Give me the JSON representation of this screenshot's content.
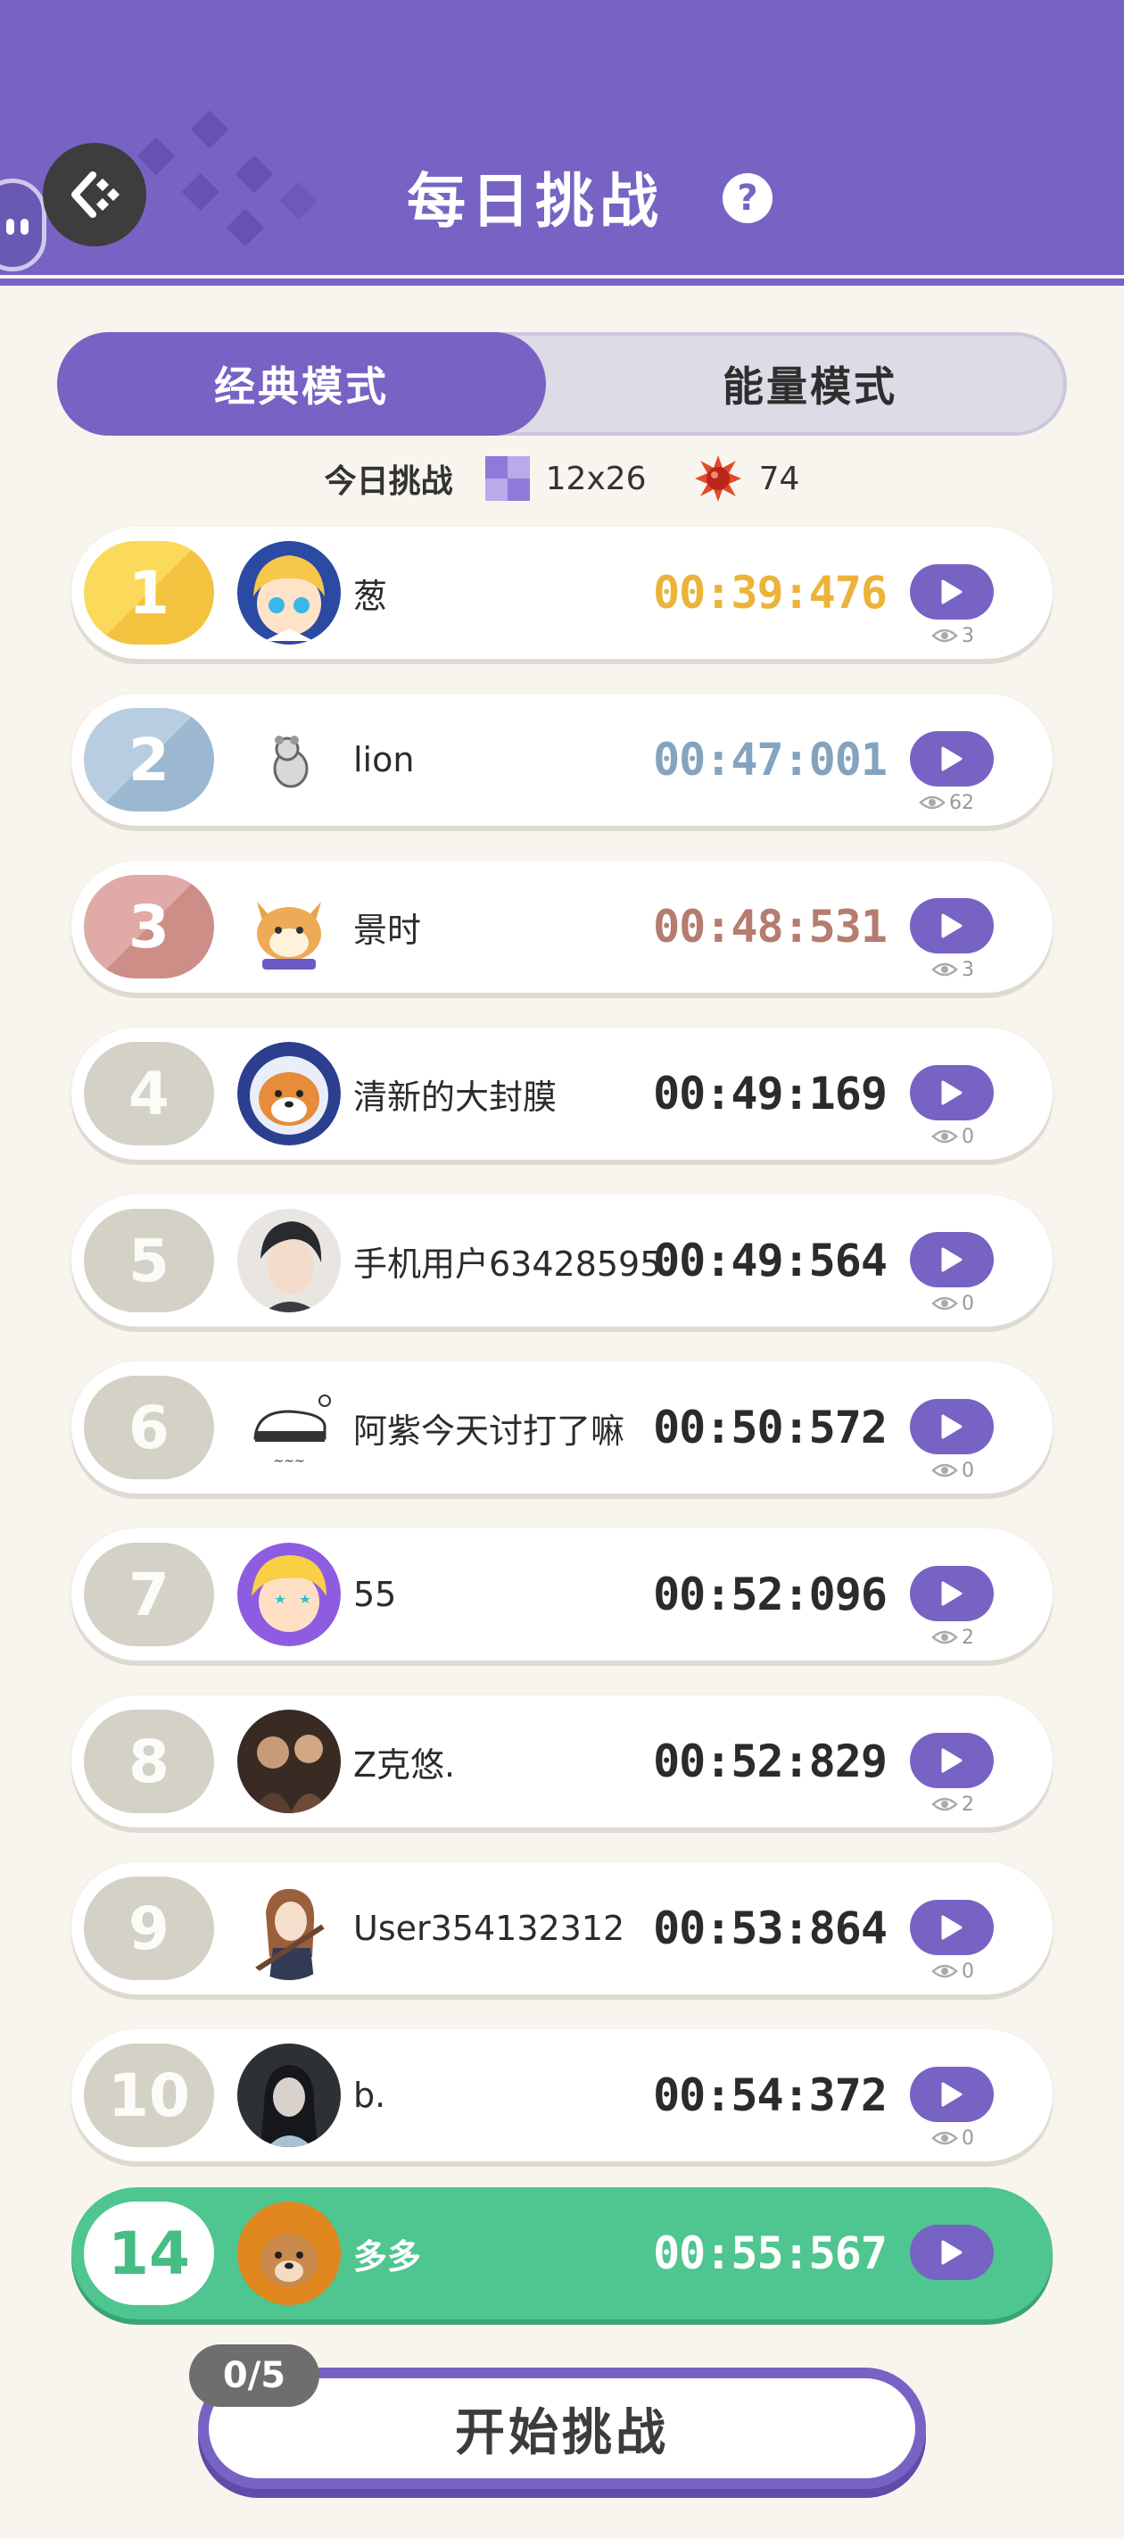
{
  "header": {
    "title": "每日挑战",
    "help": "?"
  },
  "tabs": [
    {
      "label": "经典模式",
      "active": true
    },
    {
      "label": "能量模式",
      "active": false
    }
  ],
  "today": {
    "label": "今日挑战",
    "board_size": "12x26",
    "mine_count": "74"
  },
  "leaderboard": [
    {
      "rank": "1",
      "name": "葱",
      "time": "00:39:476",
      "views": "3",
      "avatar": "anime-girl-blonde"
    },
    {
      "rank": "2",
      "name": "lion",
      "time": "00:47:001",
      "views": "62",
      "avatar": "cartoon-animal-sketch"
    },
    {
      "rank": "3",
      "name": "景时",
      "time": "00:48:531",
      "views": "3",
      "avatar": "shiba-dog-cartoon"
    },
    {
      "rank": "4",
      "name": "清新的大封膜",
      "time": "00:49:169",
      "views": "0",
      "avatar": "shiba-astronaut"
    },
    {
      "rank": "5",
      "name": "手机用户63428595",
      "time": "00:49:564",
      "views": "0",
      "avatar": "anime-boy"
    },
    {
      "rank": "6",
      "name": "阿紫今天讨打了嘛",
      "time": "00:50:572",
      "views": "0",
      "avatar": "doodle-cat"
    },
    {
      "rank": "7",
      "name": "55",
      "time": "00:52:096",
      "views": "2",
      "avatar": "anime-girl-star-eyes"
    },
    {
      "rank": "8",
      "name": "Z克悠.",
      "time": "00:52:829",
      "views": "2",
      "avatar": "photo-people"
    },
    {
      "rank": "9",
      "name": "User354132312",
      "time": "00:53:864",
      "views": "0",
      "avatar": "anime-guitar-girl"
    },
    {
      "rank": "10",
      "name": "b.",
      "time": "00:54:372",
      "views": "0",
      "avatar": "photo-girl"
    }
  ],
  "my_entry": {
    "rank": "14",
    "name": "多多",
    "time": "00:55:567",
    "avatar": "dog-photo"
  },
  "start": {
    "label": "开始挑战",
    "attempts": "0/5"
  },
  "colors": {
    "accent": "#7763c3",
    "gold": "#f3c33f",
    "silver": "#9cb8d1",
    "bronze": "#cd8e88",
    "highlight": "#4fc58f"
  }
}
